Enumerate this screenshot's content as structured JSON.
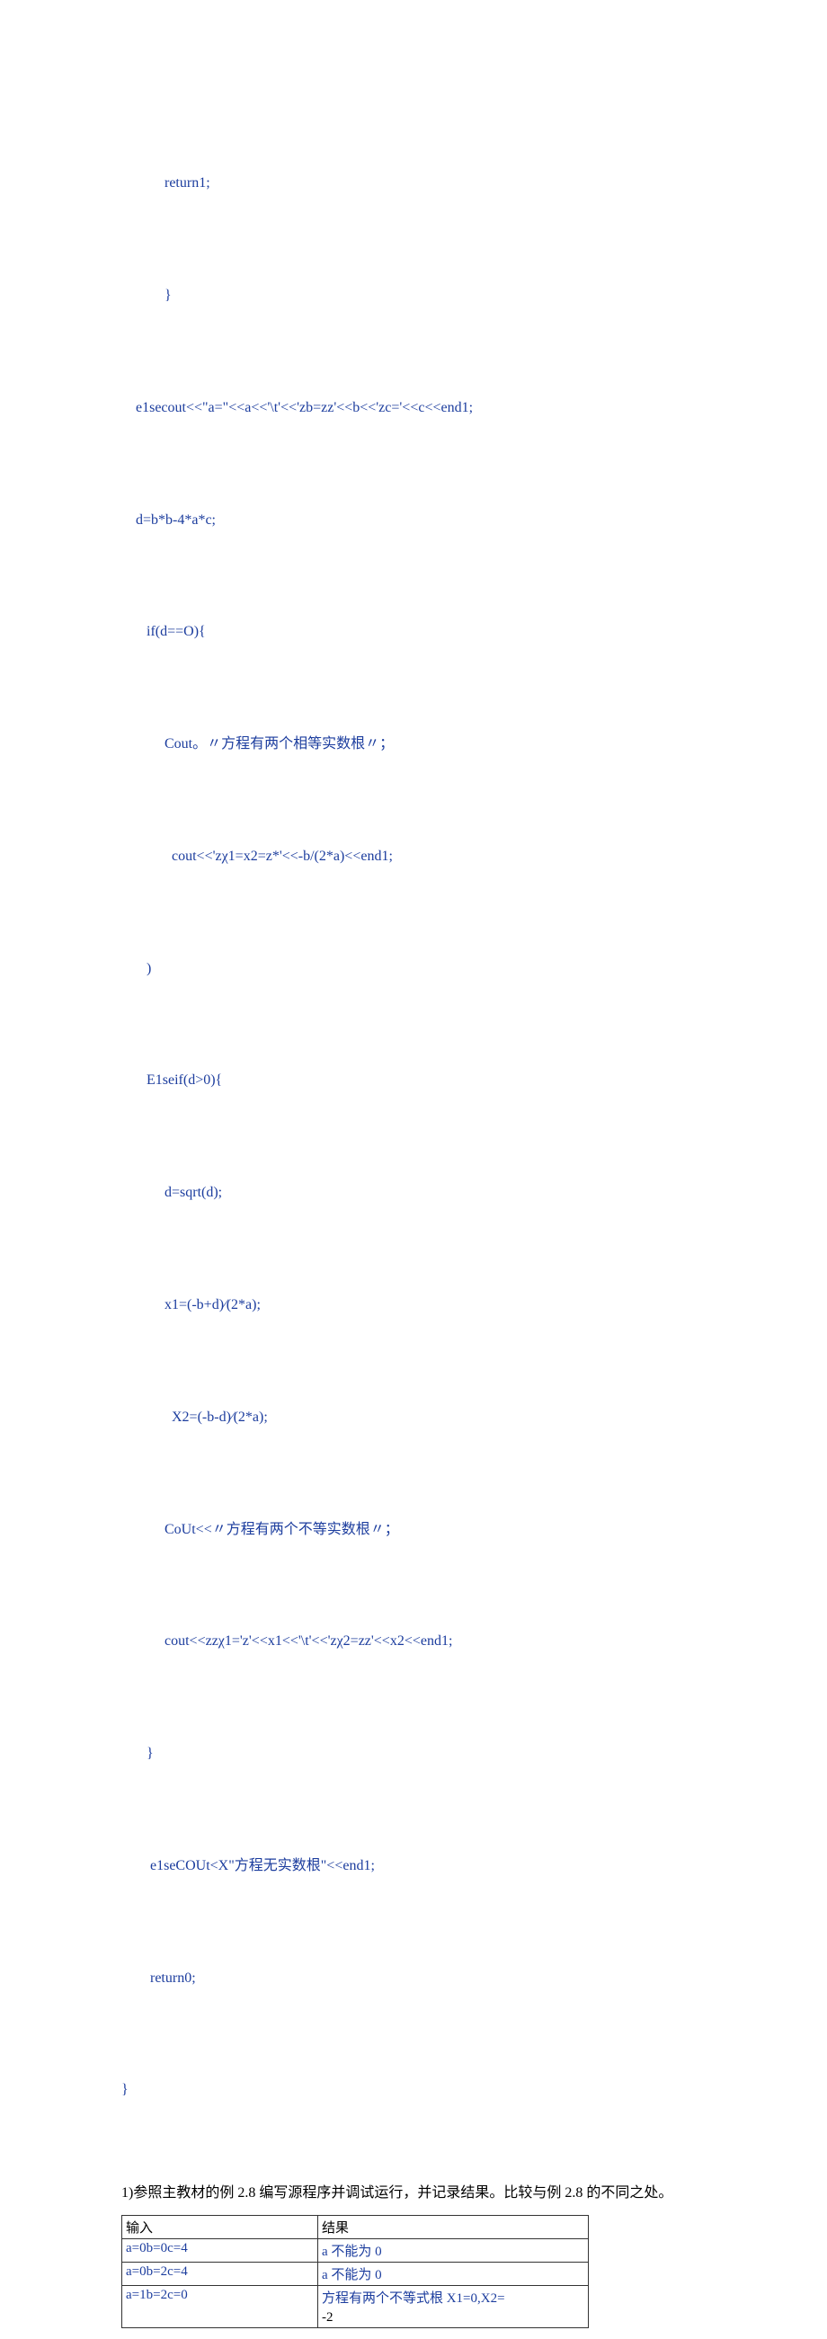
{
  "code_lines": [
    "            return1;",
    "            }",
    "    e1secout<<\"a=\"<<a<<'\\t'<<'zb=zz'<<b<<'zc='<<c<<end1;",
    "    d=b*b-4*a*c;",
    "       if(d==O){",
    "            Cout。〃方程有两个相等实数根〃；",
    "              cout<<'zχ1=x2=z*'<<-b/(2*a)<<end1;",
    "       )",
    "       E1seif(d>0){",
    "            d=sqrt(d);",
    "            x1=(-b+d)∕(2*a);",
    "              X2=(-b-d)∕(2*a);",
    "            CoUt<<〃方程有两个不等实数根〃；",
    "            cout<<zzχ1='z'<<x1<<'\\t'<<'zχ2=zz'<<x2<<end1;",
    "       }",
    "        e1seCOUt<X\"方程无实数根\"<<end1;",
    "        return0;",
    "}"
  ],
  "paragraph": "1)参照主教材的例 2.8 编写源程序并调试运行，并记录结果。比较与例 2.8 的不同之处。",
  "table": {
    "header": [
      "输入",
      "结果"
    ],
    "rows": [
      {
        "input": "a=0b=0c=4",
        "result": " a 不能为 0",
        "rowspan": 1
      },
      {
        "input": "a=0b=2c=4",
        "result": " a 不能为 0",
        "rowspan": 1
      },
      {
        "input": "a=1b=2c=0",
        "result_line1": " 方程有两个不等式根 X1=0,X2=",
        "result_line2": "-2"
      }
    ]
  }
}
